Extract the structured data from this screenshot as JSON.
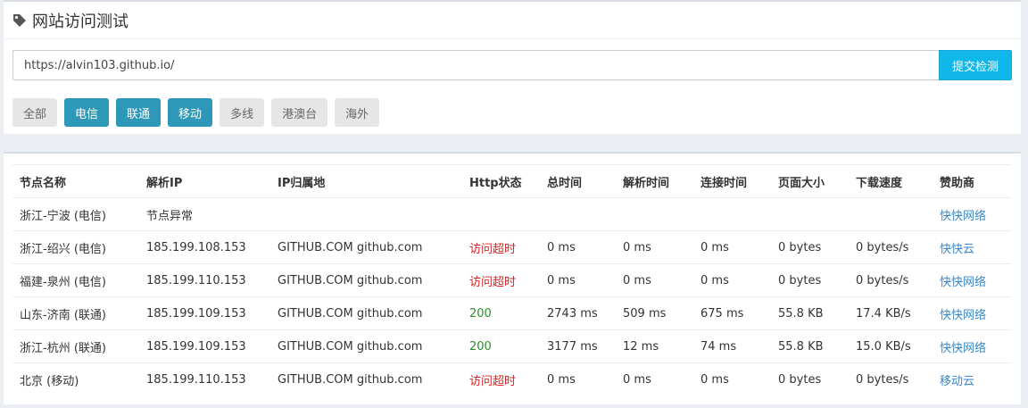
{
  "test_panel": {
    "icon": "tag-icon",
    "title": "网站访问测试",
    "url_value": "https://alvin103.github.io/",
    "submit_label": "提交检测",
    "filters": [
      {
        "label": "全部",
        "active": false
      },
      {
        "label": "电信",
        "active": true
      },
      {
        "label": "联通",
        "active": true
      },
      {
        "label": "移动",
        "active": true
      },
      {
        "label": "多线",
        "active": false
      },
      {
        "label": "港澳台",
        "active": false
      },
      {
        "label": "海外",
        "active": false
      }
    ],
    "colors": {
      "accent": "#12b7e9",
      "active_filter": "#2e98b8",
      "inactive_filter": "#e6e6e6"
    }
  },
  "results": {
    "headers": {
      "node": "节点名称",
      "ip": "解析IP",
      "location": "IP归属地",
      "http_status": "Http状态",
      "total_time": "总时间",
      "resolve_time": "解析时间",
      "connect_time": "连接时间",
      "page_size": "页面大小",
      "download_speed": "下载速度",
      "sponsor": "赞助商"
    },
    "rows": [
      {
        "node": "浙江-宁波 (电信)",
        "ip": "节点异常",
        "location": "",
        "http_status": "",
        "status_kind": "none",
        "total_time": "",
        "resolve_time": "",
        "connect_time": "",
        "page_size": "",
        "download_speed": "",
        "sponsor": "快快网络"
      },
      {
        "node": "浙江-绍兴 (电信)",
        "ip": "185.199.108.153",
        "location": "GITHUB.COM github.com",
        "http_status": "访问超时",
        "status_kind": "timeout",
        "total_time": "0 ms",
        "resolve_time": "0 ms",
        "connect_time": "0 ms",
        "page_size": "0 bytes",
        "download_speed": "0 bytes/s",
        "sponsor": "快快云"
      },
      {
        "node": "福建-泉州 (电信)",
        "ip": "185.199.110.153",
        "location": "GITHUB.COM github.com",
        "http_status": "访问超时",
        "status_kind": "timeout",
        "total_time": "0 ms",
        "resolve_time": "0 ms",
        "connect_time": "0 ms",
        "page_size": "0 bytes",
        "download_speed": "0 bytes/s",
        "sponsor": "快快网络"
      },
      {
        "node": "山东-济南 (联通)",
        "ip": "185.199.109.153",
        "location": "GITHUB.COM github.com",
        "http_status": "200",
        "status_kind": "ok",
        "total_time": "2743 ms",
        "resolve_time": "509 ms",
        "connect_time": "675 ms",
        "page_size": "55.8 KB",
        "download_speed": "17.4 KB/s",
        "sponsor": "快快网络"
      },
      {
        "node": "浙江-杭州 (联通)",
        "ip": "185.199.109.153",
        "location": "GITHUB.COM github.com",
        "http_status": "200",
        "status_kind": "ok",
        "total_time": "3177 ms",
        "resolve_time": "12 ms",
        "connect_time": "74 ms",
        "page_size": "55.8 KB",
        "download_speed": "15.0 KB/s",
        "sponsor": "快快网络"
      },
      {
        "node": "北京 (移动)",
        "ip": "185.199.110.153",
        "location": "GITHUB.COM github.com",
        "http_status": "访问超时",
        "status_kind": "timeout",
        "total_time": "0 ms",
        "resolve_time": "0 ms",
        "connect_time": "0 ms",
        "page_size": "0 bytes",
        "download_speed": "0 bytes/s",
        "sponsor": "移动云"
      }
    ],
    "colors": {
      "timeout": "#e02020",
      "ok": "#2e8b2e",
      "sponsor_link": "#3a87c8"
    }
  }
}
